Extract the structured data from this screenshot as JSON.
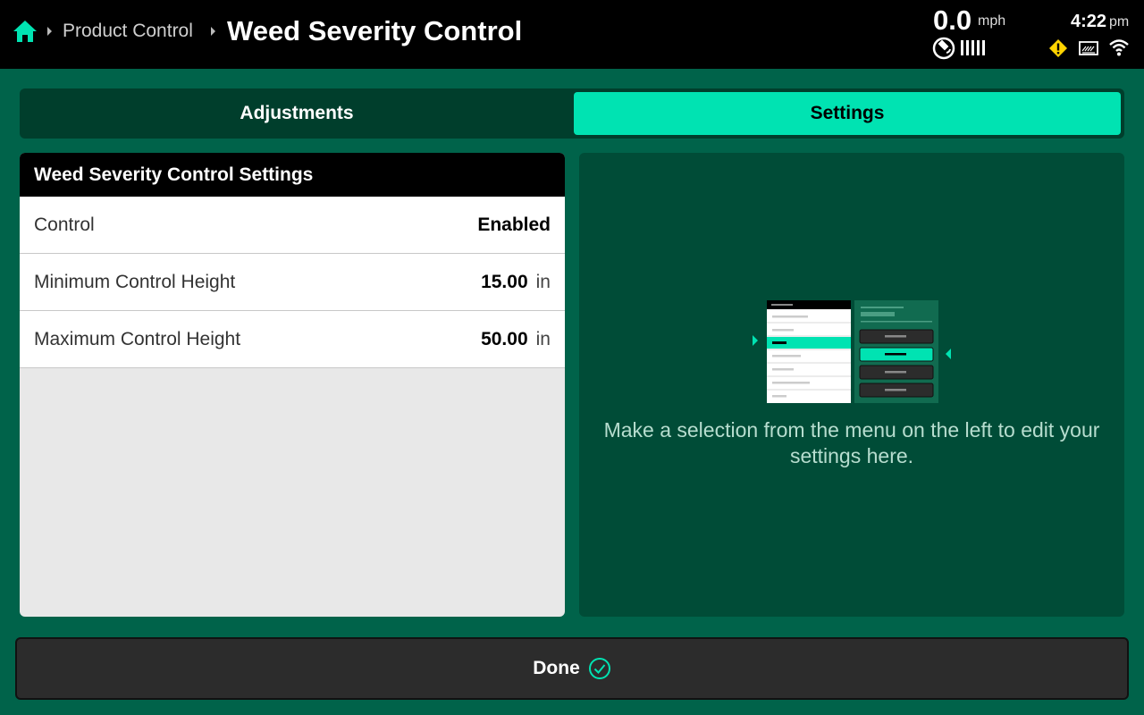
{
  "header": {
    "breadcrumb_parent": "Product Control",
    "title": "Weed Severity Control",
    "speed_value": "0.0",
    "speed_unit": "mph",
    "time": "4:22",
    "ampm": "pm"
  },
  "tabs": [
    {
      "label": "Adjustments",
      "active": false
    },
    {
      "label": "Settings",
      "active": true
    }
  ],
  "settings_panel": {
    "title": "Weed Severity Control Settings",
    "rows": [
      {
        "label": "Control",
        "value": "Enabled",
        "unit": ""
      },
      {
        "label": "Minimum Control Height",
        "value": "15.00",
        "unit": "in"
      },
      {
        "label": "Maximum Control Height",
        "value": "50.00",
        "unit": "in"
      }
    ]
  },
  "help": {
    "text": "Make a selection from the menu on the left to edit your settings here."
  },
  "footer": {
    "done_label": "Done"
  },
  "colors": {
    "background": "#00634a",
    "accent": "#00e3b2",
    "warning": "#ffd400"
  }
}
